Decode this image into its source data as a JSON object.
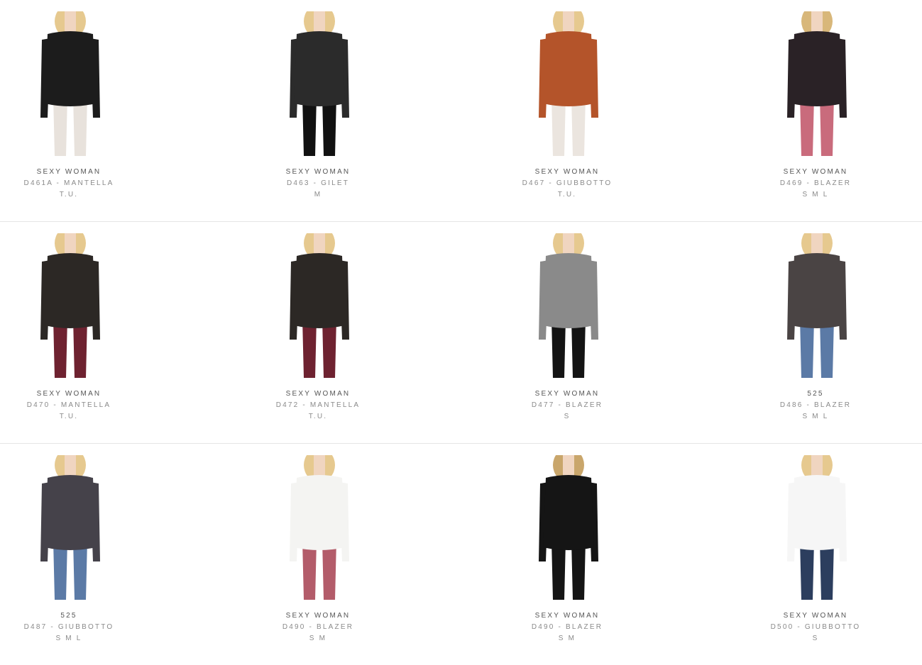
{
  "products": [
    {
      "brand": "SEXY WOMAN",
      "code": "D461A - MANTELLA",
      "sizes": "T.U.",
      "colors": {
        "top": "#1c1c1c",
        "bottom": "#e8e2dc",
        "skin": "#f0d5c0",
        "hair": "#e6c98f"
      }
    },
    {
      "brand": "SEXY WOMAN",
      "code": "D463 - GILET",
      "sizes": "M",
      "colors": {
        "top": "#2b2b2b",
        "bottom": "#111111",
        "skin": "#f0d5c0",
        "hair": "#e6c98f"
      }
    },
    {
      "brand": "SEXY WOMAN",
      "code": "D467 - GIUBBOTTO",
      "sizes": "T.U.",
      "colors": {
        "top": "#b4542a",
        "bottom": "#ebe5df",
        "skin": "#f0d5c0",
        "hair": "#e6c98f"
      }
    },
    {
      "brand": "SEXY WOMAN",
      "code": "D469 - BLAZER",
      "sizes": "S M L",
      "colors": {
        "top": "#2a2226",
        "bottom": "#c96b7c",
        "skin": "#f0d5c0",
        "hair": "#d8b77a"
      }
    },
    {
      "brand": "SEXY WOMAN",
      "code": "D470 - MANTELLA",
      "sizes": "T.U.",
      "colors": {
        "top": "#2c2825",
        "bottom": "#6e2230",
        "skin": "#f0d5c0",
        "hair": "#e6c98f"
      }
    },
    {
      "brand": "SEXY WOMAN",
      "code": "D472 - MANTELLA",
      "sizes": "T.U.",
      "colors": {
        "top": "#2c2825",
        "bottom": "#6e2230",
        "skin": "#f0d5c0",
        "hair": "#e6c98f"
      }
    },
    {
      "brand": "SEXY WOMAN",
      "code": "D477 - BLAZER",
      "sizes": "S",
      "colors": {
        "top": "#8a8a8a",
        "bottom": "#141414",
        "skin": "#f0d5c0",
        "hair": "#e6c98f"
      }
    },
    {
      "brand": "525",
      "code": "D486 - BLAZER",
      "sizes": "S M L",
      "colors": {
        "top": "#4a4444",
        "bottom": "#5b7aa6",
        "skin": "#f0d5c0",
        "hair": "#e6c98f"
      }
    },
    {
      "brand": "525",
      "code": "D487 - GIUBBOTTO",
      "sizes": "S M L",
      "colors": {
        "top": "#45424a",
        "bottom": "#5b7aa6",
        "skin": "#f0d5c0",
        "hair": "#e6c98f"
      }
    },
    {
      "brand": "SEXY WOMAN",
      "code": "D490 - BLAZER",
      "sizes": "S M",
      "colors": {
        "top": "#f4f4f2",
        "bottom": "#b35c6a",
        "skin": "#f0d5c0",
        "hair": "#e6c98f"
      }
    },
    {
      "brand": "SEXY WOMAN",
      "code": "D490 - BLAZER",
      "sizes": "S M",
      "colors": {
        "top": "#151515",
        "bottom": "#151515",
        "skin": "#f0d5c0",
        "hair": "#c9a66b"
      }
    },
    {
      "brand": "SEXY WOMAN",
      "code": "D500 - GIUBBOTTO",
      "sizes": "S",
      "colors": {
        "top": "#f6f6f6",
        "bottom": "#2c3e5e",
        "skin": "#f0d5c0",
        "hair": "#e6c98f"
      }
    }
  ]
}
